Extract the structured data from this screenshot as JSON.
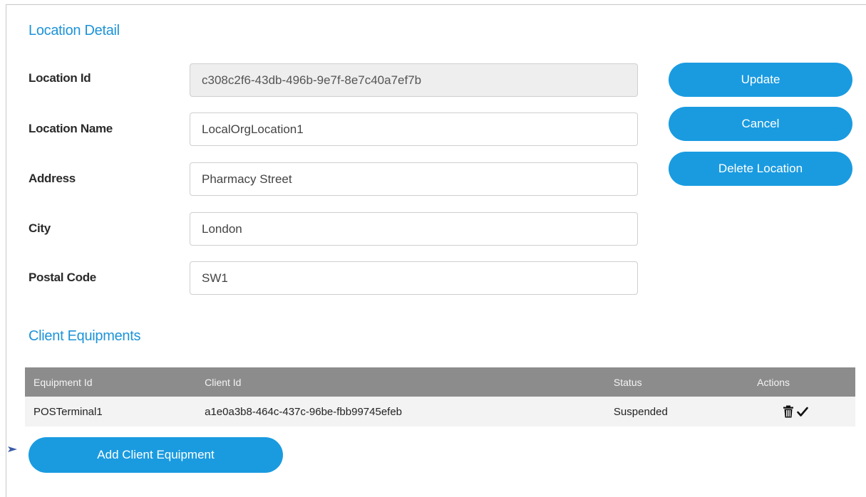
{
  "location_detail": {
    "title": "Location Detail",
    "fields": [
      {
        "label": "Location Id",
        "value": "c308c2f6-43db-496b-9e7f-8e7c40a7ef7b",
        "readonly": true
      },
      {
        "label": "Location Name",
        "value": "LocalOrgLocation1",
        "readonly": false
      },
      {
        "label": "Address",
        "value": "Pharmacy Street",
        "readonly": false
      },
      {
        "label": "City",
        "value": "London",
        "readonly": false
      },
      {
        "label": "Postal Code",
        "value": "SW1",
        "readonly": false
      }
    ],
    "buttons": {
      "update": "Update",
      "cancel": "Cancel",
      "delete": "Delete Location"
    }
  },
  "client_equipments": {
    "title": "Client Equipments",
    "columns": [
      "Equipment Id",
      "Client Id",
      "Status",
      "Actions"
    ],
    "rows": [
      {
        "equipment_id": "POSTerminal1",
        "client_id": "a1e0a3b8-464c-437c-96be-fbb99745efeb",
        "status": "Suspended",
        "actions": [
          "trash-icon",
          "checkmark-icon"
        ]
      }
    ],
    "add_button": "Add Client Equipment"
  },
  "colors": {
    "accent": "#1a9be0",
    "section_title": "#1d93d8",
    "table_header": "#8c8c8c",
    "table_row": "#f3f3f3",
    "readonly_field": "#eeeeee"
  }
}
